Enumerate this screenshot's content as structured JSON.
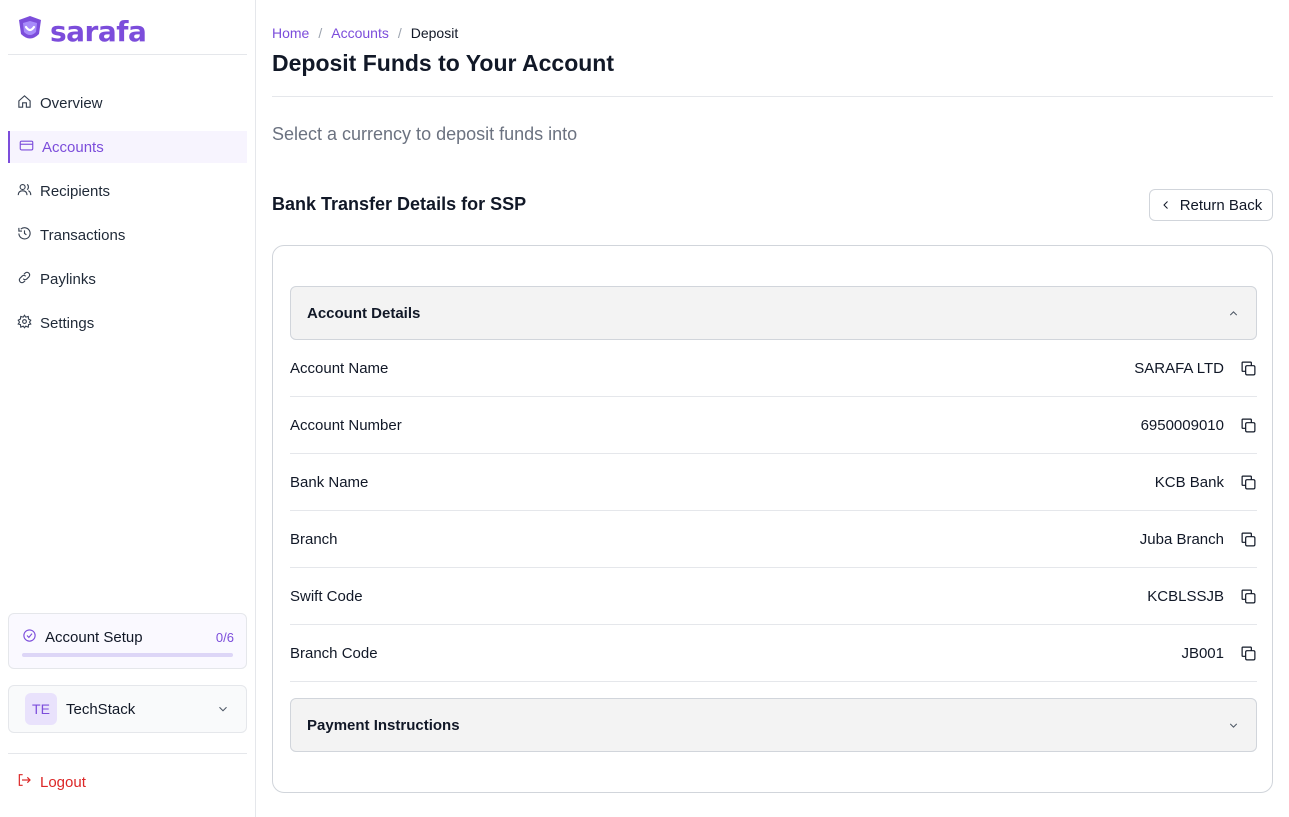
{
  "brand": {
    "name": "sarafa",
    "color": "#7c4ddb"
  },
  "sidebar": {
    "items": [
      {
        "label": "Overview",
        "icon": "home-icon",
        "active": false
      },
      {
        "label": "Accounts",
        "icon": "credit-card-icon",
        "active": true
      },
      {
        "label": "Recipients",
        "icon": "users-icon",
        "active": false
      },
      {
        "label": "Transactions",
        "icon": "history-icon",
        "active": false
      },
      {
        "label": "Paylinks",
        "icon": "link-icon",
        "active": false
      },
      {
        "label": "Settings",
        "icon": "gear-icon",
        "active": false
      }
    ],
    "setup": {
      "label": "Account Setup",
      "count": "0/6",
      "progress": 0
    },
    "org": {
      "initials": "TE",
      "name": "TechStack"
    },
    "logout_label": "Logout"
  },
  "breadcrumb": {
    "home": "Home",
    "accounts": "Accounts",
    "current": "Deposit",
    "separator": "/"
  },
  "page": {
    "title": "Deposit Funds to Your Account",
    "subtitle": "Select a currency to deposit funds into",
    "section_title": "Bank Transfer Details for SSP",
    "return_label": "Return Back"
  },
  "account_details": {
    "header": "Account Details",
    "rows": [
      {
        "label": "Account Name",
        "value": "SARAFA LTD"
      },
      {
        "label": "Account Number",
        "value": "6950009010"
      },
      {
        "label": "Bank Name",
        "value": "KCB Bank"
      },
      {
        "label": "Branch",
        "value": "Juba Branch"
      },
      {
        "label": "Swift Code",
        "value": "KCBLSSJB"
      },
      {
        "label": "Branch Code",
        "value": "JB001"
      }
    ]
  },
  "payment_instructions": {
    "header": "Payment Instructions"
  },
  "colors": {
    "accent": "#7c4ddb",
    "danger": "#dc2626",
    "muted": "#6b7280"
  }
}
